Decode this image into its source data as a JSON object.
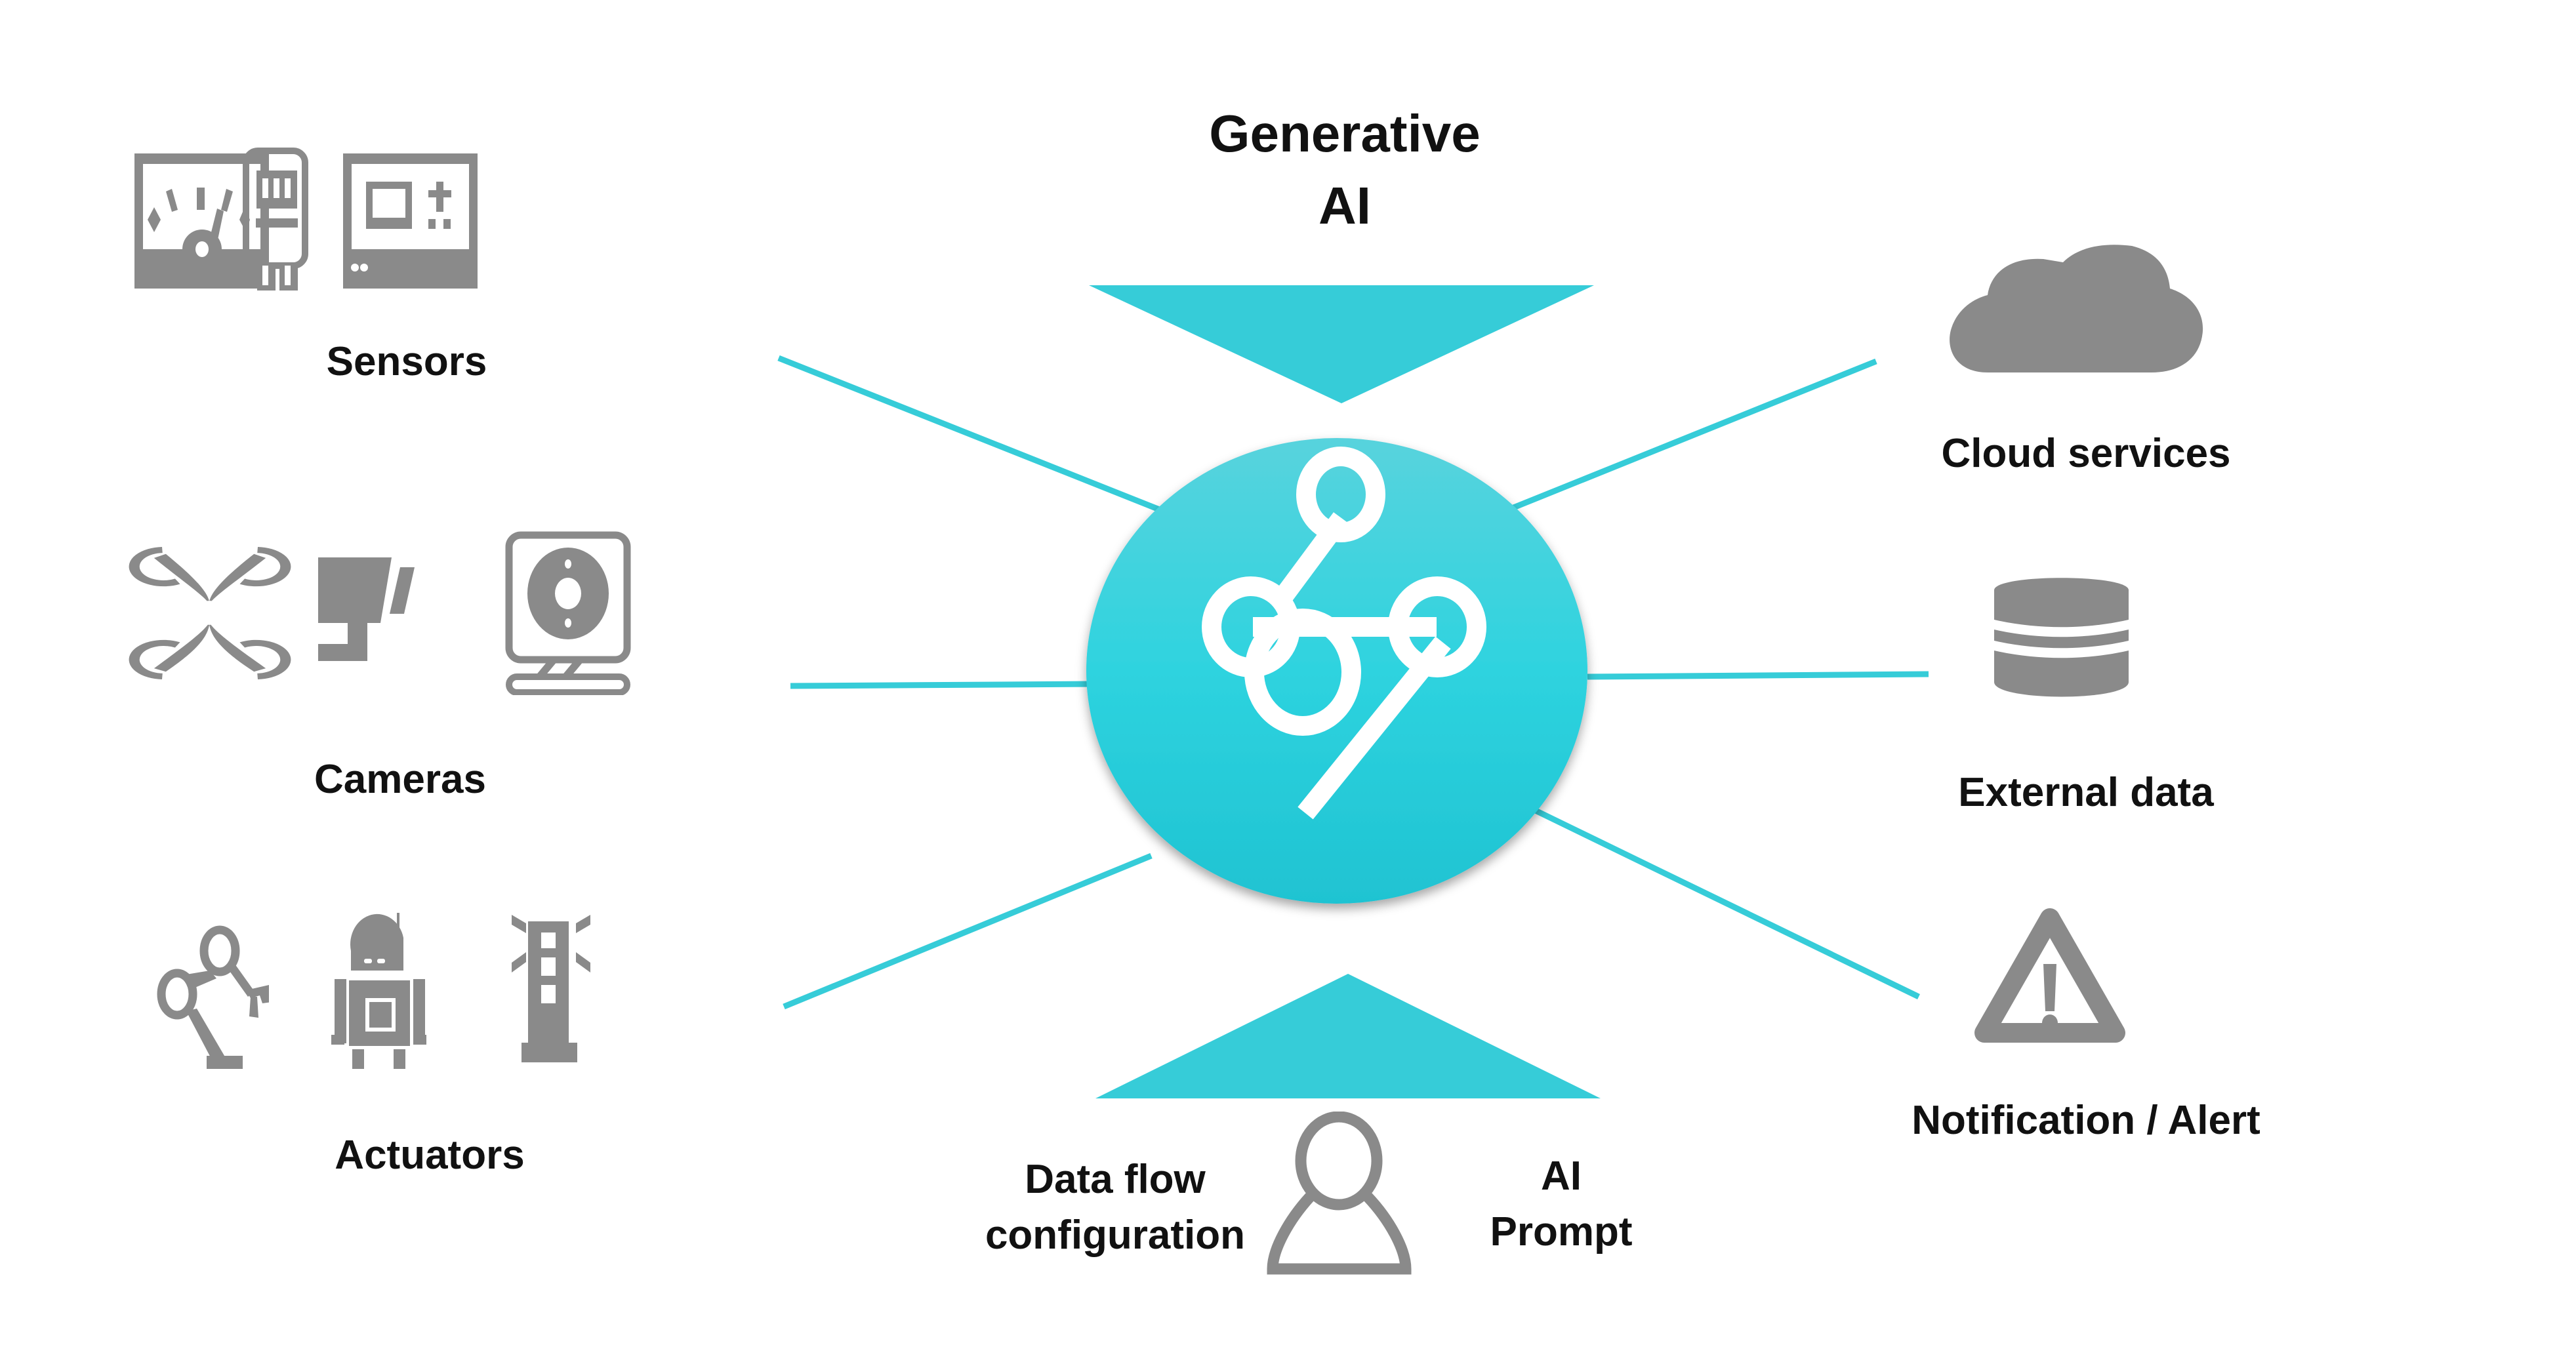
{
  "colors": {
    "accent": "#36CCD8",
    "accent_light": "#58D3DD",
    "accent_dark": "#1FC3D2",
    "icon_gray": "#8A8A8A",
    "text": "#111111",
    "background": "#FFFFFF"
  },
  "title": {
    "line1": "Generative",
    "line2": "AI"
  },
  "hub": {
    "icon": "node-graph-icon"
  },
  "left_groups": [
    {
      "label": "Sensors",
      "icons": [
        "gauge-meter-icon",
        "electric-meter-icon",
        "control-panel-icon"
      ]
    },
    {
      "label": "Cameras",
      "icons": [
        "drone-icon",
        "security-camera-icon",
        "webcam-icon"
      ]
    },
    {
      "label": "Actuators",
      "icons": [
        "robot-arm-icon",
        "robot-icon",
        "signal-tower-icon"
      ]
    }
  ],
  "right_groups": [
    {
      "label": "Cloud services",
      "icon": "cloud-icon"
    },
    {
      "label": "External data",
      "icon": "database-icon"
    },
    {
      "label": "Notification / Alert",
      "icon": "warning-icon"
    }
  ],
  "bottom": {
    "left_label_line1": "Data flow",
    "left_label_line2": "configuration",
    "right_label_line1": "AI",
    "right_label_line2": "Prompt",
    "icon": "user-icon"
  }
}
